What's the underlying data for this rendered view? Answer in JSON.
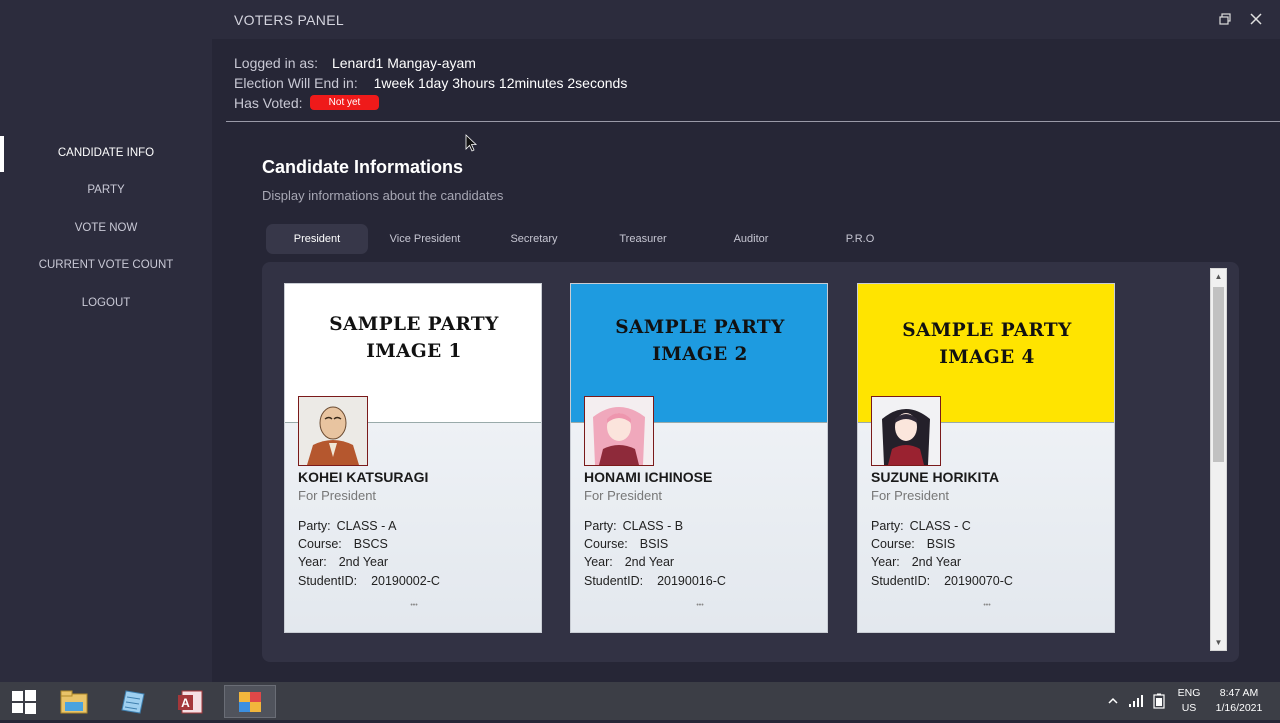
{
  "window": {
    "title": "VOTERS PANEL",
    "restore_symbol": "⧉",
    "close_symbol": "✕"
  },
  "sidebar": {
    "items": [
      {
        "label": "CANDIDATE INFO"
      },
      {
        "label": "PARTY"
      },
      {
        "label": "VOTE NOW"
      },
      {
        "label": "CURRENT VOTE COUNT"
      },
      {
        "label": "LOGOUT"
      }
    ],
    "active_index": 0
  },
  "session": {
    "logged_in_label": "Logged in as:",
    "logged_in_value": "Lenard1 Mangay-ayam",
    "election_label": "Election Will End in:",
    "election_value": "1week 1day 3hours 12minutes 2seconds",
    "voted_label": "Has Voted:",
    "voted_badge": "Not yet",
    "voted_badge_color": "#ef1a1a"
  },
  "main": {
    "title": "Candidate Informations",
    "subtitle": "Display informations about the candidates",
    "tabs": [
      {
        "label": "President"
      },
      {
        "label": "Vice President"
      },
      {
        "label": "Secretary"
      },
      {
        "label": "Treasurer"
      },
      {
        "label": "Auditor"
      },
      {
        "label": "P.R.O"
      }
    ],
    "active_tab": 0
  },
  "candidates": [
    {
      "banner_line1": "SAMPLE PARTY",
      "banner_line2": "IMAGE 1",
      "banner_color": "#ffffff",
      "name": "KOHEI KATSURAGI",
      "role": "For President",
      "party_label": "Party:",
      "party": "CLASS - A",
      "course_label": "Course:",
      "course": "BSCS",
      "year_label": "Year:",
      "year": "2nd Year",
      "id_label": "StudentID:",
      "student_id": "20190002-C"
    },
    {
      "banner_line1": "SAMPLE PARTY",
      "banner_line2": "IMAGE 2",
      "banner_color": "#1e9be0",
      "name": "HONAMI ICHINOSE",
      "role": "For President",
      "party_label": "Party:",
      "party": "CLASS - B",
      "course_label": "Course:",
      "course": "BSIS",
      "year_label": "Year:",
      "year": "2nd Year",
      "id_label": "StudentID:",
      "student_id": "20190016-C"
    },
    {
      "banner_line1": "SAMPLE PARTY",
      "banner_line2": "IMAGE 4",
      "banner_color": "#ffe400",
      "name": "SUZUNE HORIKITA",
      "role": "For President",
      "party_label": "Party:",
      "party": "CLASS - C",
      "course_label": "Course:",
      "course": "BSIS",
      "year_label": "Year:",
      "year": "2nd Year",
      "id_label": "StudentID:",
      "student_id": "20190070-C"
    }
  ],
  "taskbar": {
    "lang_line1": "ENG",
    "lang_line2": "US",
    "time": "8:47 AM",
    "date": "1/16/2021"
  }
}
